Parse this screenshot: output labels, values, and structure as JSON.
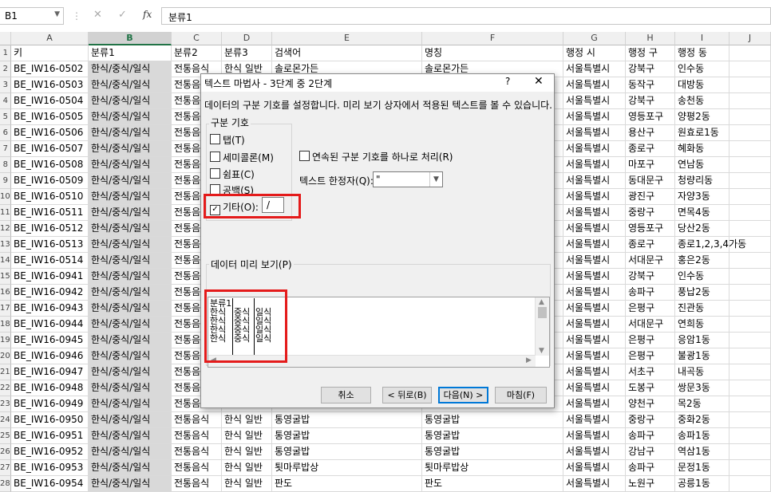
{
  "formula_bar": {
    "name_box": "B1",
    "name_box_arrow": "▼",
    "separator": "⋮",
    "cancel_icon": "✕",
    "enter_icon": "✓",
    "fx_label": "fx",
    "formula_value": "분류1"
  },
  "columns": [
    "A",
    "B",
    "C",
    "D",
    "E",
    "F",
    "G",
    "H",
    "I",
    "J"
  ],
  "selected_column": "B",
  "rows": [
    {
      "num": "1",
      "a": "키",
      "b": "분류1",
      "c": "분류2",
      "d": "분류3",
      "e": "검색어",
      "f": "명칭",
      "g": "행정 시",
      "h": "행정 구",
      "i": "행정 동"
    },
    {
      "num": "2",
      "a": "BE_IW16-0502",
      "b": "한식/중식/일식",
      "c": "전통음식",
      "d": "한식 일반",
      "e": "솔로몬가든",
      "f": "솔로몬가든",
      "g": "서울특별시",
      "h": "강북구",
      "i": "인수동"
    },
    {
      "num": "3",
      "a": "BE_IW16-0503",
      "b": "한식/중식/일식",
      "c": "전통음식",
      "d": "",
      "e": "",
      "f": "",
      "g": "서울특별시",
      "h": "동작구",
      "i": "대방동"
    },
    {
      "num": "4",
      "a": "BE_IW16-0504",
      "b": "한식/중식/일식",
      "c": "전통음식",
      "d": "",
      "e": "",
      "f": "",
      "g": "서울특별시",
      "h": "강북구",
      "i": "송천동"
    },
    {
      "num": "5",
      "a": "BE_IW16-0505",
      "b": "한식/중식/일식",
      "c": "전통음식",
      "d": "",
      "e": "",
      "f": "",
      "g": "서울특별시",
      "h": "영등포구",
      "i": "양평2동"
    },
    {
      "num": "6",
      "a": "BE_IW16-0506",
      "b": "한식/중식/일식",
      "c": "전통음식",
      "d": "",
      "e": "",
      "f": "",
      "g": "서울특별시",
      "h": "용산구",
      "i": "원효로1동"
    },
    {
      "num": "7",
      "a": "BE_IW16-0507",
      "b": "한식/중식/일식",
      "c": "전통음식",
      "d": "",
      "e": "",
      "f": "",
      "g": "서울특별시",
      "h": "종로구",
      "i": "혜화동"
    },
    {
      "num": "8",
      "a": "BE_IW16-0508",
      "b": "한식/중식/일식",
      "c": "전통음식",
      "d": "",
      "e": "",
      "f": "",
      "g": "서울특별시",
      "h": "마포구",
      "i": "연남동"
    },
    {
      "num": "9",
      "a": "BE_IW16-0509",
      "b": "한식/중식/일식",
      "c": "전통음식",
      "d": "",
      "e": "",
      "f": "",
      "g": "서울특별시",
      "h": "동대문구",
      "i": "청량리동"
    },
    {
      "num": "10",
      "a": "BE_IW16-0510",
      "b": "한식/중식/일식",
      "c": "전통음식",
      "d": "",
      "e": "",
      "f": "",
      "g": "서울특별시",
      "h": "광진구",
      "i": "자양3동"
    },
    {
      "num": "11",
      "a": "BE_IW16-0511",
      "b": "한식/중식/일식",
      "c": "전통음식",
      "d": "",
      "e": "",
      "f": "",
      "g": "서울특별시",
      "h": "중랑구",
      "i": "면목4동"
    },
    {
      "num": "12",
      "a": "BE_IW16-0512",
      "b": "한식/중식/일식",
      "c": "전통음식",
      "d": "",
      "e": "",
      "f": "",
      "g": "서울특별시",
      "h": "영등포구",
      "i": "당산2동"
    },
    {
      "num": "13",
      "a": "BE_IW16-0513",
      "b": "한식/중식/일식",
      "c": "전통음식",
      "d": "",
      "e": "",
      "f": "",
      "g": "서울특별시",
      "h": "종로구",
      "i": "종로1,2,3,4가동"
    },
    {
      "num": "14",
      "a": "BE_IW16-0514",
      "b": "한식/중식/일식",
      "c": "전통음식",
      "d": "",
      "e": "",
      "f": "",
      "g": "서울특별시",
      "h": "서대문구",
      "i": "홍은2동"
    },
    {
      "num": "15",
      "a": "BE_IW16-0941",
      "b": "한식/중식/일식",
      "c": "전통음식",
      "d": "",
      "e": "",
      "f": "",
      "g": "서울특별시",
      "h": "강북구",
      "i": "인수동"
    },
    {
      "num": "16",
      "a": "BE_IW16-0942",
      "b": "한식/중식/일식",
      "c": "전통음식",
      "d": "",
      "e": "",
      "f": "",
      "g": "서울특별시",
      "h": "송파구",
      "i": "풍납2동"
    },
    {
      "num": "17",
      "a": "BE_IW16-0943",
      "b": "한식/중식/일식",
      "c": "전통음식",
      "d": "",
      "e": "",
      "f": "",
      "g": "서울특별시",
      "h": "은평구",
      "i": "진관동"
    },
    {
      "num": "18",
      "a": "BE_IW16-0944",
      "b": "한식/중식/일식",
      "c": "전통음식",
      "d": "",
      "e": "",
      "f": "",
      "g": "서울특별시",
      "h": "서대문구",
      "i": "연희동"
    },
    {
      "num": "19",
      "a": "BE_IW16-0945",
      "b": "한식/중식/일식",
      "c": "전통음식",
      "d": "",
      "e": "",
      "f": "",
      "g": "서울특별시",
      "h": "은평구",
      "i": "응암1동"
    },
    {
      "num": "20",
      "a": "BE_IW16-0946",
      "b": "한식/중식/일식",
      "c": "전통음식",
      "d": "",
      "e": "",
      "f": "",
      "g": "서울특별시",
      "h": "은평구",
      "i": "불광1동"
    },
    {
      "num": "21",
      "a": "BE_IW16-0947",
      "b": "한식/중식/일식",
      "c": "전통음식",
      "d": "",
      "e": "",
      "f": "",
      "g": "서울특별시",
      "h": "서초구",
      "i": "내곡동"
    },
    {
      "num": "22",
      "a": "BE_IW16-0948",
      "b": "한식/중식/일식",
      "c": "전통음식",
      "d": "",
      "e": "",
      "f": "",
      "g": "서울특별시",
      "h": "도봉구",
      "i": "쌍문3동"
    },
    {
      "num": "23",
      "a": "BE_IW16-0949",
      "b": "한식/중식/일식",
      "c": "전통음식",
      "d": "",
      "e": "",
      "f": "",
      "g": "서울특별시",
      "h": "양천구",
      "i": "목2동"
    },
    {
      "num": "24",
      "a": "BE_IW16-0950",
      "b": "한식/중식/일식",
      "c": "전통음식",
      "d": "한식 일반",
      "e": "통영굴밥",
      "f": "통영굴밥",
      "g": "서울특별시",
      "h": "중랑구",
      "i": "중화2동"
    },
    {
      "num": "25",
      "a": "BE_IW16-0951",
      "b": "한식/중식/일식",
      "c": "전통음식",
      "d": "한식 일반",
      "e": "통영굴밥",
      "f": "통영굴밥",
      "g": "서울특별시",
      "h": "송파구",
      "i": "송파1동"
    },
    {
      "num": "26",
      "a": "BE_IW16-0952",
      "b": "한식/중식/일식",
      "c": "전통음식",
      "d": "한식 일반",
      "e": "통영굴밥",
      "f": "통영굴밥",
      "g": "서울특별시",
      "h": "강남구",
      "i": "역삼1동"
    },
    {
      "num": "27",
      "a": "BE_IW16-0953",
      "b": "한식/중식/일식",
      "c": "전통음식",
      "d": "한식 일반",
      "e": "툇마루밥상",
      "f": "툇마루밥상",
      "g": "서울특별시",
      "h": "송파구",
      "i": "문정1동"
    },
    {
      "num": "28",
      "a": "BE_IW16-0954",
      "b": "한식/중식/일식",
      "c": "전통음식",
      "d": "한식 일반",
      "e": "판도",
      "f": "판도",
      "g": "서울특별시",
      "h": "노원구",
      "i": "공릉1동"
    }
  ],
  "dialog": {
    "title": "텍스트 마법사 - 3단계 중 2단계",
    "help_label": "?",
    "close_label": "✕",
    "description": "데이터의 구분 기호를 설정합니다. 미리 보기 상자에서 적용된 텍스트를 볼 수 있습니다.",
    "delimiter_group_label": "구분 기호",
    "delimiters": [
      {
        "label": "탭(T)",
        "checked": false
      },
      {
        "label": "세미콜론(M)",
        "checked": false
      },
      {
        "label": "쉼표(C)",
        "checked": false
      },
      {
        "label": "공백(S)",
        "checked": false
      },
      {
        "label": "기타(O):",
        "checked": true
      }
    ],
    "other_value": "/",
    "consecutive_label": "연속된 구분 기호를 하나로 처리(R)",
    "consecutive_checked": false,
    "qualifier_label": "텍스트 한정자(Q):",
    "qualifier_value": "\"",
    "preview_label": "데이터 미리 보기(P)",
    "preview_header": "분류1",
    "preview_rows": [
      [
        "한식",
        "중식",
        "일식"
      ],
      [
        "한식",
        "중식",
        "일식"
      ],
      [
        "한식",
        "중식",
        "일식"
      ],
      [
        "한식",
        "중식",
        "일식"
      ]
    ],
    "buttons": {
      "cancel": "취소",
      "back": "< 뒤로(B)",
      "next": "다음(N) >",
      "finish": "마침(F)"
    }
  },
  "colors": {
    "selected_column": "#d9d9d9",
    "excel_green": "#217346",
    "highlight_red": "#e41b1b",
    "primary_button_border": "#0078d7"
  }
}
